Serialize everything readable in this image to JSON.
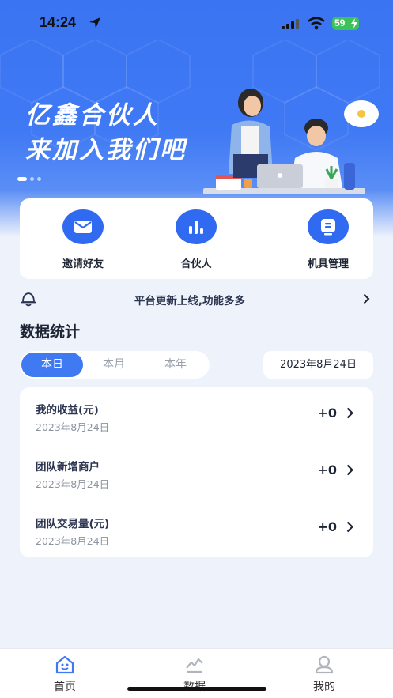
{
  "status_bar": {
    "time": "14:24",
    "battery": "59"
  },
  "banner": {
    "line1": "亿鑫合伙人",
    "line2": "来加入我们吧"
  },
  "quick_actions": [
    {
      "label": "邀请好友",
      "icon": "mail-icon"
    },
    {
      "label": "合伙人",
      "icon": "bar-chart-icon"
    },
    {
      "label": "机具管理",
      "icon": "device-icon"
    }
  ],
  "notice": {
    "text": "平台更新上线,功能多多"
  },
  "stats": {
    "title": "数据统计",
    "tabs": [
      "本日",
      "本月",
      "本年"
    ],
    "active_tab": "本日",
    "date": "2023年8月24日",
    "rows": [
      {
        "title": "我的收益(元)",
        "date": "2023年8月24日",
        "value": "+0"
      },
      {
        "title": "团队新增商户",
        "date": "2023年8月24日",
        "value": "+0"
      },
      {
        "title": "团队交易量(元)",
        "date": "2023年8月24日",
        "value": "+0"
      }
    ]
  },
  "tabbar": {
    "items": [
      {
        "label": "首页",
        "icon": "home-icon",
        "active": true
      },
      {
        "label": "数据",
        "icon": "data-icon"
      },
      {
        "label": "我的",
        "icon": "profile-icon"
      }
    ]
  },
  "colors": {
    "primary": "#3f7af3",
    "banner": "#3b74f2",
    "background": "#eef2fb"
  }
}
